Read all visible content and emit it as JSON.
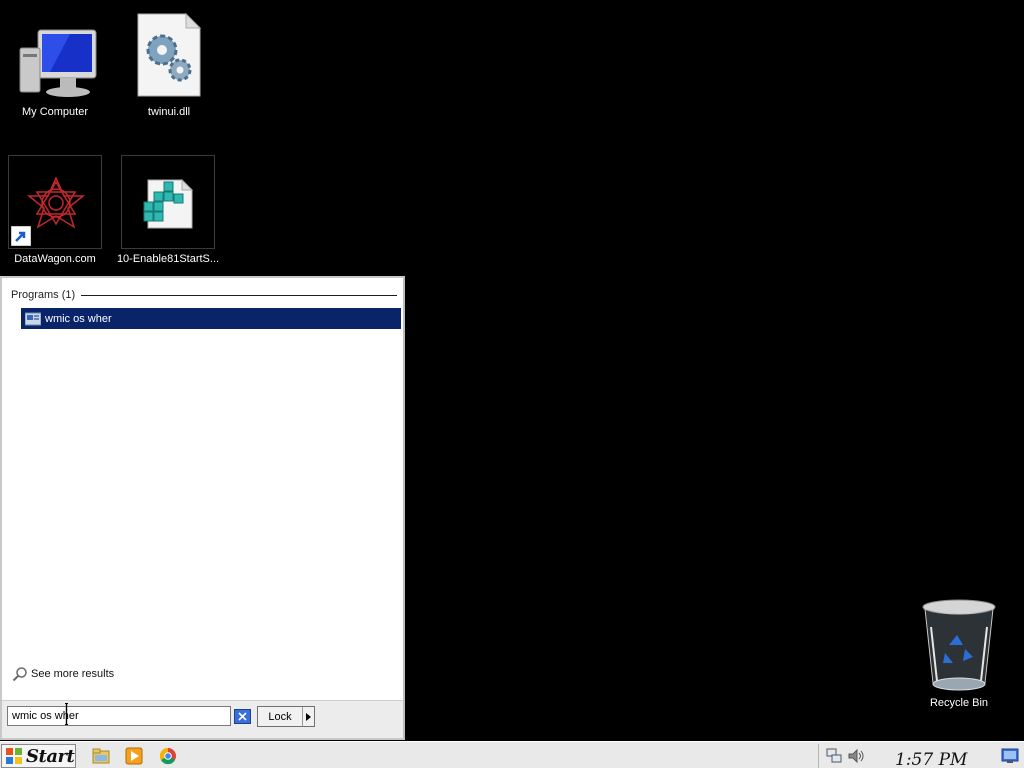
{
  "desktop": {
    "icons": [
      {
        "label": "My Computer"
      },
      {
        "label": "twinui.dll"
      },
      {
        "label": "DataWagon.com"
      },
      {
        "label": "10-Enable81StartS..."
      },
      {
        "label": "Recycle Bin"
      }
    ]
  },
  "start_menu": {
    "programs_header": "Programs (1)",
    "results": [
      {
        "label": "wmic os wher"
      }
    ],
    "see_more": "See more results",
    "search_value": "wmic os wher",
    "lock_label": "Lock"
  },
  "taskbar": {
    "start_label": "Start",
    "clock": "1:57 PM"
  },
  "colors": {
    "selection": "#0a246a",
    "desktop": "#000000",
    "taskbar": "#e9e9e9"
  }
}
